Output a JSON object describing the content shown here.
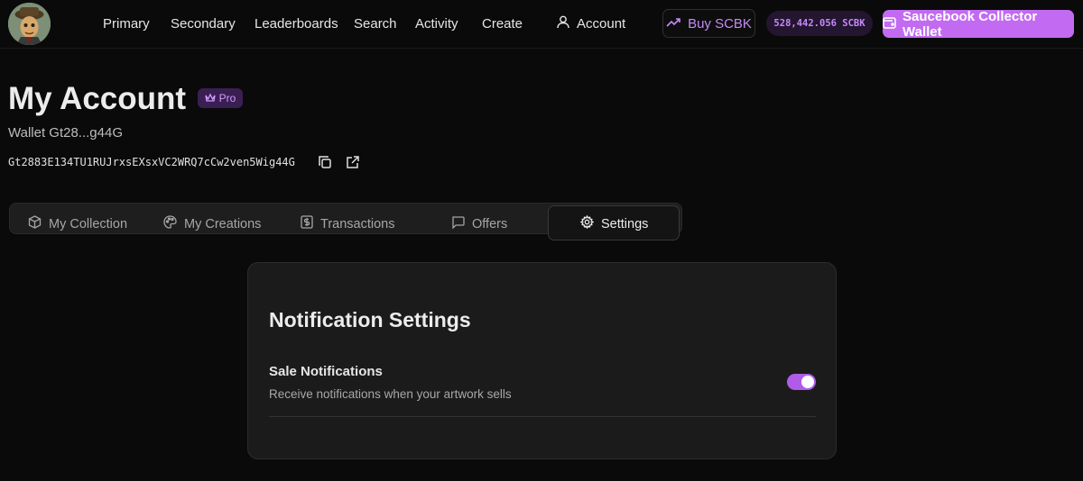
{
  "header": {
    "nav": [
      "Primary",
      "Secondary",
      "Leaderboards",
      "Search",
      "Activity",
      "Create"
    ],
    "account_label": "Account",
    "buy_label": "Buy SCBK",
    "balance": "528,442.056 SCBK",
    "wallet_button": "Saucebook Collector Wallet"
  },
  "profile": {
    "title": "My Account",
    "badge": "Pro",
    "wallet_short": "Wallet Gt28...g44G",
    "wallet_full": "Gt2883E134TU1RUJrxsEXsxVC2WRQ7cCw2ven5Wig44G"
  },
  "tabs": [
    {
      "label": "My Collection",
      "icon": "cube-icon"
    },
    {
      "label": "My Creations",
      "icon": "palette-icon"
    },
    {
      "label": "Transactions",
      "icon": "dollar-receipt-icon"
    },
    {
      "label": "Offers",
      "icon": "message-icon"
    },
    {
      "label": "Settings",
      "icon": "gear-icon",
      "active": true
    }
  ],
  "settings": {
    "title": "Notification Settings",
    "items": [
      {
        "label": "Sale Notifications",
        "description": "Receive notifications when your artwork sells",
        "enabled": true
      }
    ]
  },
  "colors": {
    "accent": "#c26bf2",
    "background": "#0a0a0a",
    "card": "#1b1b1c"
  }
}
